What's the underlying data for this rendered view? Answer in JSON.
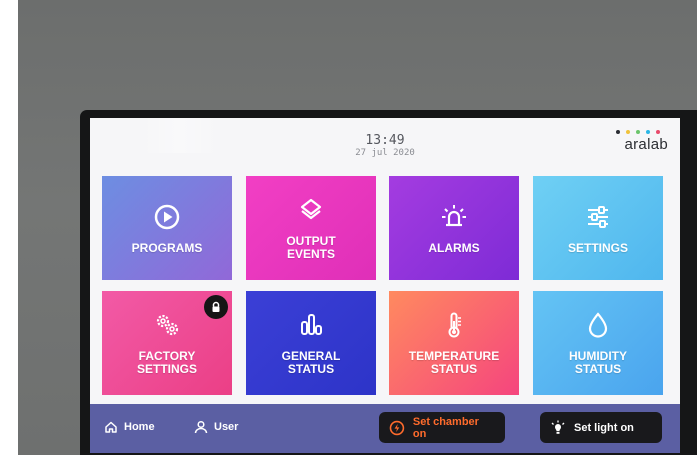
{
  "status": {
    "time": "13:49",
    "date": "27 jul 2020"
  },
  "brand": {
    "name": "aralab",
    "dot_colors": [
      "#2b2d33",
      "#f0c23b",
      "#6bc46b",
      "#2bb6e6",
      "#e84a6b"
    ]
  },
  "tiles": [
    {
      "label": "PROGRAMS",
      "icon": "play-circle-icon",
      "colors": [
        "#6d8ee2",
        "#9168d8"
      ]
    },
    {
      "label": "OUTPUT\nEVENTS",
      "icon": "layers-icon",
      "colors": [
        "#f23fc4",
        "#df2fb8"
      ]
    },
    {
      "label": "ALARMS",
      "icon": "siren-icon",
      "colors": [
        "#a43ce0",
        "#7e2bd6"
      ]
    },
    {
      "label": "SETTINGS",
      "icon": "sliders-icon",
      "colors": [
        "#6fd0f4",
        "#4fb6ee"
      ]
    },
    {
      "label": "FACTORY\nSETTINGS",
      "icon": "gears-icon",
      "colors": [
        "#f25aa6",
        "#eb3f86"
      ],
      "locked": true,
      "lock_icon": "lock-icon"
    },
    {
      "label": "GENERAL\nSTATUS",
      "icon": "bar-chart-icon",
      "colors": [
        "#3b3fd6",
        "#2d34c8"
      ]
    },
    {
      "label": "TEMPERATURE\nSTATUS",
      "icon": "thermometer-icon",
      "colors": [
        "#ff8a5f",
        "#f5457e"
      ]
    },
    {
      "label": "HUMIDITY\nSTATUS",
      "icon": "droplet-icon",
      "colors": [
        "#64c4f4",
        "#4aa4ee"
      ]
    }
  ],
  "bottom_bar": {
    "home_label": "Home",
    "home_icon": "home-icon",
    "user_label": "User",
    "user_icon": "user-icon",
    "chamber_label": "Set chamber on",
    "chamber_icon": "power-icon",
    "chamber_color": "#ff6b2c",
    "light_label": "Set light on",
    "light_icon": "lightbulb-icon"
  }
}
